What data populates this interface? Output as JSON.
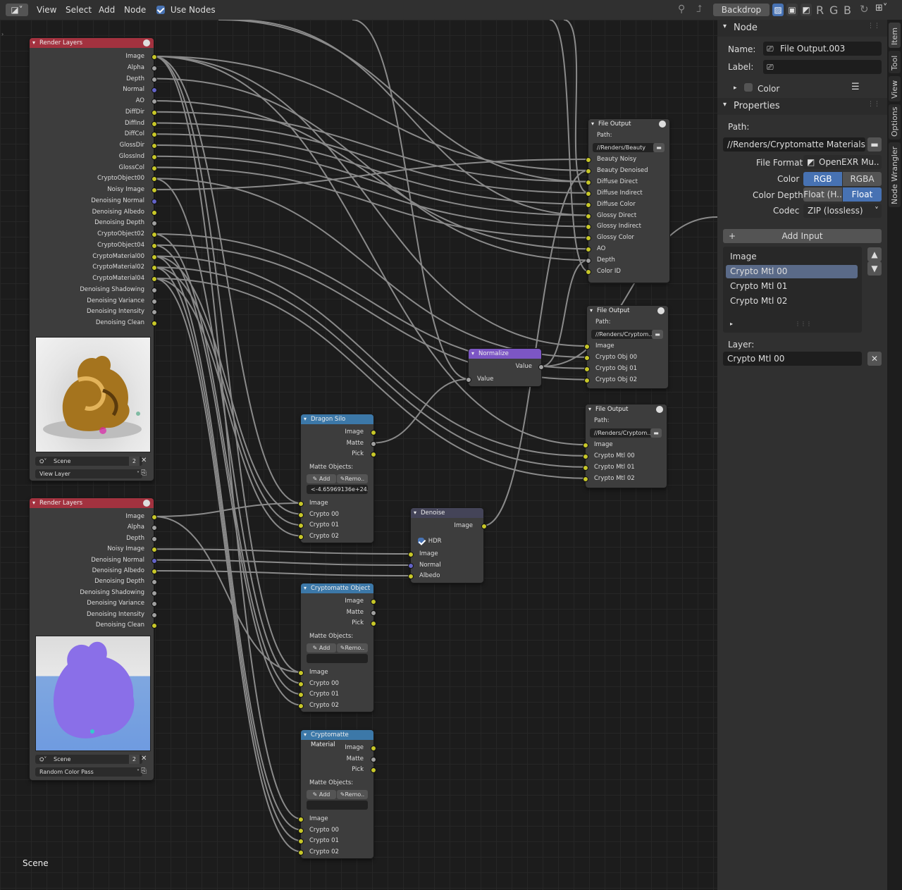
{
  "header": {
    "menu": [
      "View",
      "Select",
      "Add",
      "Node"
    ],
    "use_nodes_label": "Use Nodes",
    "backdrop_label": "Backdrop",
    "channels": [
      "R",
      "G",
      "B"
    ]
  },
  "canvas": {
    "scene_label": "Scene"
  },
  "nodes": {
    "rl1": {
      "title": "Render Layers",
      "outputs": [
        "Image",
        "Alpha",
        "Depth",
        "Normal",
        "AO",
        "DiffDir",
        "DiffInd",
        "DiffCol",
        "GlossDir",
        "GlossInd",
        "GlossCol",
        "CryptoObject00",
        "Noisy Image",
        "Denoising Normal",
        "Denoising Albedo",
        "Denoising Depth",
        "CryptoObject02",
        "CryptoObject04",
        "CryptoMaterial00",
        "CryptoMaterial02",
        "CryptoMaterial04",
        "Denoising Shadowing",
        "Denoising Variance",
        "Denoising Intensity",
        "Denoising Clean"
      ],
      "scene": "Scene",
      "scene_users": "2",
      "layer": "View Layer"
    },
    "rl2": {
      "title": "Render Layers",
      "outputs": [
        "Image",
        "Alpha",
        "Depth",
        "Noisy Image",
        "Denoising Normal",
        "Denoising Albedo",
        "Denoising Depth",
        "Denoising Shadowing",
        "Denoising Variance",
        "Denoising Intensity",
        "Denoising Clean"
      ],
      "scene": "Scene",
      "scene_users": "2",
      "layer": "Random Color Pass"
    },
    "dragon": {
      "title": "Dragon Silo",
      "outputs": [
        "Image",
        "Matte",
        "Pick"
      ],
      "matte_label": "Matte Objects:",
      "add": "Add",
      "remove": "Remo..",
      "matte_value": "<-4.65969136e+24..",
      "inputs": [
        "Image",
        "Crypto 00",
        "Crypto 01",
        "Crypto 02"
      ]
    },
    "cobj": {
      "title": "Cryptomatte Object",
      "outputs": [
        "Image",
        "Matte",
        "Pick"
      ],
      "matte_label": "Matte Objects:",
      "add": "Add",
      "remove": "Remo..",
      "matte_value": "",
      "inputs": [
        "Image",
        "Crypto 00",
        "Crypto 01",
        "Crypto 02"
      ]
    },
    "cmat": {
      "title": "Cryptomatte Material",
      "outputs": [
        "Image",
        "Matte",
        "Pick"
      ],
      "matte_label": "Matte Objects:",
      "add": "Add",
      "remove": "Remo..",
      "matte_value": "",
      "inputs": [
        "Image",
        "Crypto 00",
        "Crypto 01",
        "Crypto 02"
      ]
    },
    "denoise": {
      "title": "Denoise",
      "output": "Image",
      "hdr": "HDR",
      "inputs": [
        "Image",
        "Normal",
        "Albedo"
      ]
    },
    "normalize": {
      "title": "Normalize",
      "output": "Value",
      "input": "Value"
    },
    "fo1": {
      "title": "File Output",
      "path_label": "Path:",
      "path": "//Renders/Beauty",
      "inputs": [
        "Beauty Noisy",
        "Beauty Denoised",
        "Diffuse Direct",
        "Diffuse Indirect",
        "Diffuse Color",
        "Glossy Direct",
        "Glossy Indirect",
        "Glossy Color",
        "AO",
        "Depth",
        "Color ID"
      ]
    },
    "fo2": {
      "title": "File Output",
      "path_label": "Path:",
      "path": "//Renders/Cryptom..",
      "inputs": [
        "Image",
        "Crypto Obj 00",
        "Crypto Obj 01",
        "Crypto Obj 02"
      ]
    },
    "fo3": {
      "title": "File Output",
      "path_label": "Path:",
      "path": "//Renders/Cryptom..",
      "inputs": [
        "Image",
        "Crypto Mtl 00",
        "Crypto Mtl 01",
        "Crypto Mtl 02"
      ]
    }
  },
  "sidebar": {
    "node_header": "Node",
    "name_label": "Name:",
    "name_value": "File Output.003",
    "label_label": "Label:",
    "label_value": "",
    "color_label": "Color",
    "properties_header": "Properties",
    "path_label": "Path:",
    "path_value": "//Renders/Cryptomatte Materials",
    "file_format_label": "File Format",
    "file_format_value": "OpenEXR Mu..",
    "color_mode_label": "Color",
    "color_modes": [
      "RGB",
      "RGBA"
    ],
    "color_depth_label": "Color Depth",
    "color_depths": [
      "Float (H..",
      "Float (Fu.."
    ],
    "codec_label": "Codec",
    "codec_value": "ZIP (lossless)",
    "add_input_label": "Add Input",
    "inputs_list": [
      "Image",
      "Crypto Mtl 00",
      "Crypto Mtl 01",
      "Crypto Mtl 02"
    ],
    "selected_input_index": 1,
    "layer_label": "Layer:",
    "layer_value": "Crypto Mtl 00"
  },
  "tabs": [
    "Item",
    "Tool",
    "View",
    "Options",
    "Node Wrangler"
  ],
  "colors": {
    "render_layers_header": "#a3323f",
    "cryptomatte_header": "#3c78a8",
    "normalize_header": "#7c56c4",
    "denoise_header": "#444458",
    "output_header": "#3d3d3d",
    "socket_color": "#c7c729",
    "socket_vector": "#6363c7",
    "socket_gray": "#a1a1a1",
    "accent": "#4772b3"
  }
}
